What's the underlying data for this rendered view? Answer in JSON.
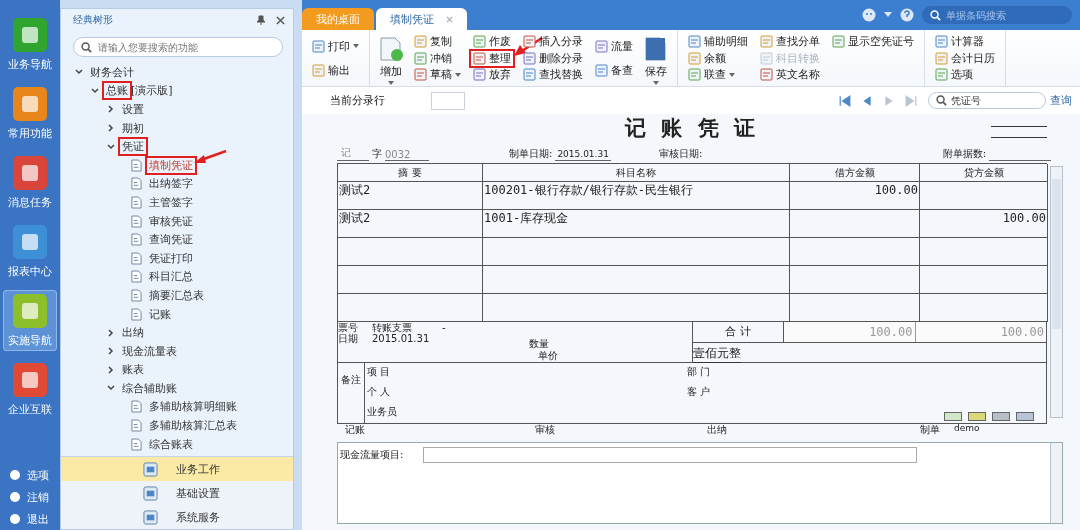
{
  "rail": {
    "items": [
      {
        "label": "业务导航",
        "selected": false
      },
      {
        "label": "常用功能",
        "selected": false
      },
      {
        "label": "消息任务",
        "selected": false
      },
      {
        "label": "报表中心",
        "selected": false
      },
      {
        "label": "实施导航",
        "selected": true
      },
      {
        "label": "企业互联",
        "selected": false
      }
    ],
    "bottom": [
      "选项",
      "注销",
      "退出"
    ]
  },
  "tree_panel": {
    "title": "经典树形",
    "search": {
      "placeholder": "请输入您要搜索的功能"
    },
    "tree": [
      {
        "label": "财务会计",
        "expanded": true,
        "selected": false,
        "children": [
          {
            "label": "总账",
            "note": "[演示版]",
            "expanded": true,
            "selected": false,
            "annotated": true,
            "children": [
              {
                "label": "设置",
                "expanded": false,
                "selected": false
              },
              {
                "label": "期初",
                "expanded": false,
                "selected": false
              },
              {
                "label": "凭证",
                "expanded": true,
                "selected": false,
                "annotated": true,
                "children": [
                  {
                    "label": "填制凭证",
                    "selected": true,
                    "annotated": true,
                    "arrow": true
                  },
                  {
                    "label": "出纳签字",
                    "selected": false
                  },
                  {
                    "label": "主管签字",
                    "selected": false
                  },
                  {
                    "label": "审核凭证",
                    "selected": false
                  },
                  {
                    "label": "查询凭证",
                    "selected": false
                  },
                  {
                    "label": "凭证打印",
                    "selected": false
                  },
                  {
                    "label": "科目汇总",
                    "selected": false
                  },
                  {
                    "label": "摘要汇总表",
                    "selected": false
                  },
                  {
                    "label": "记账",
                    "selected": false
                  }
                ]
              },
              {
                "label": "出纳",
                "expanded": false,
                "selected": false
              },
              {
                "label": "现金流量表",
                "expanded": false,
                "selected": false
              },
              {
                "label": "账表",
                "expanded": false,
                "selected": false
              },
              {
                "label": "综合辅助账",
                "expanded": true,
                "selected": false,
                "children": [
                  {
                    "label": "多辅助核算明细账",
                    "selected": false
                  },
                  {
                    "label": "多辅助核算汇总表",
                    "selected": false
                  },
                  {
                    "label": "综合账表",
                    "selected": false
                  }
                ]
              }
            ]
          }
        ]
      }
    ],
    "nav": [
      {
        "label": "业务工作",
        "selected": true
      },
      {
        "label": "基础设置",
        "selected": false
      },
      {
        "label": "系统服务",
        "selected": false
      }
    ]
  },
  "tabs": [
    {
      "label": "我的桌面",
      "selected": false,
      "closable": false
    },
    {
      "label": "填制凭证",
      "selected": true,
      "closable": true
    }
  ],
  "header_search": {
    "placeholder": "单据条码搜索"
  },
  "toolbar": [
    [
      [
        {
          "label": "打印",
          "kind": "small",
          "dropdown": true
        },
        {
          "label": "输出",
          "kind": "small"
        }
      ]
    ],
    [
      [
        {
          "label": "增加",
          "kind": "large",
          "dropdown": true
        }
      ],
      [
        {
          "label": "复制",
          "kind": "small"
        },
        {
          "label": "冲销",
          "kind": "small"
        },
        {
          "label": "草稿",
          "kind": "small",
          "dropdown": true
        }
      ],
      [
        {
          "label": "作废",
          "kind": "small"
        },
        {
          "label": "整理",
          "kind": "small",
          "annotated": true,
          "arrow": true
        },
        {
          "label": "放弃",
          "kind": "small"
        }
      ],
      [
        {
          "label": "插入分录",
          "kind": "small"
        },
        {
          "label": "删除分录",
          "kind": "small"
        },
        {
          "label": "查找替换",
          "kind": "small"
        }
      ],
      [
        {
          "label": "流量",
          "kind": "small"
        },
        {
          "label": "备查",
          "kind": "small"
        }
      ],
      [
        {
          "label": "保存",
          "kind": "large",
          "dropdown": true
        }
      ]
    ],
    [
      [
        {
          "label": "辅助明细",
          "kind": "small"
        },
        {
          "label": "余额",
          "kind": "small"
        },
        {
          "label": "联查",
          "kind": "small",
          "dropdown": true
        }
      ],
      [
        {
          "label": "查找分单",
          "kind": "small"
        },
        {
          "label": "科目转换",
          "kind": "small",
          "disabled": true
        },
        {
          "label": "英文名称",
          "kind": "small"
        }
      ],
      [
        {
          "label": "显示空凭证号",
          "kind": "small"
        }
      ]
    ],
    [
      [
        {
          "label": "计算器",
          "kind": "small"
        },
        {
          "label": "会计日历",
          "kind": "small"
        },
        {
          "label": "选项",
          "kind": "small"
        }
      ]
    ]
  ],
  "entry_bar": {
    "label": "当前分录行",
    "search": {
      "placeholder": "凭证号"
    },
    "query_link": "查询"
  },
  "voucher": {
    "title": "记 账 凭 证",
    "type": "记",
    "type_suffix": "字",
    "number": "0032",
    "date_label": "制单日期:",
    "date": "2015.01.31",
    "audit_label": "审核日期:",
    "attach_label": "附单据数:",
    "columns": [
      "摘 要",
      "科目名称",
      "借方金额",
      "贷方金额"
    ],
    "rows": [
      {
        "summary": "测试2",
        "account": "100201-银行存款/银行存款-民生银行",
        "debit": "100.00"
      },
      {
        "summary": "测试2",
        "account": "1001-库存现金",
        "credit": "100.00"
      },
      {},
      {},
      {}
    ],
    "footer": {
      "ticket_label": "票号",
      "ticket": "转账支票",
      "ticket_dash": "-",
      "date_label": "日期",
      "date": "2015.01.31",
      "qty_label": "数量",
      "price_label": "单价",
      "total_label": "合 计",
      "total_debit": "100.00",
      "total_credit": "100.00",
      "amount_words": "壹佰元整"
    },
    "remarks": {
      "label": "备注",
      "left": [
        "项 目",
        "个 人",
        "业务员"
      ],
      "right": [
        "部 门",
        "客 户"
      ]
    },
    "signatures": [
      {
        "label": "记账"
      },
      {
        "label": "审核"
      },
      {
        "label": "出纳"
      },
      {
        "label": "制单",
        "value": "demo"
      }
    ]
  },
  "cash_flow": {
    "label": "现金流量项目:"
  }
}
